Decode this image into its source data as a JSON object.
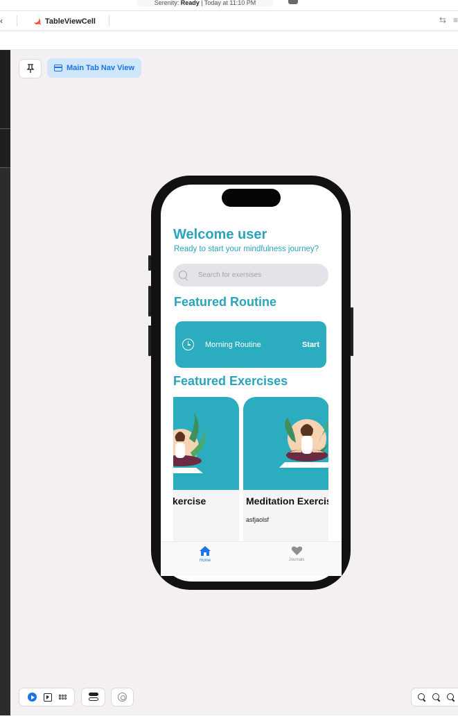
{
  "window": {
    "status_text_prefix": "Serenity: ",
    "status_text_bold": "Ready",
    "status_text_suffix": " | Today at 11:10 PM"
  },
  "editor_tabs": {
    "prev_tab": "‹",
    "active_file": "TableViewCell",
    "active_file_icon": "swift-icon"
  },
  "canvas": {
    "pin_icon": "pin-icon",
    "preview_chip_label": "Main Tab Nav View",
    "accent": "#1a73e8",
    "bottom_controls": [
      "play-icon",
      "cursor-icon",
      "grid-icon",
      "toggle-icon",
      "target-icon"
    ],
    "zoom_controls": [
      "zoom-out-icon",
      "zoom-fit-icon",
      "zoom-in-icon"
    ]
  },
  "app": {
    "brand_color": "#2aa3bd",
    "welcome_title": "Welcome user",
    "welcome_subtitle": "Ready to start your mindfulness journey?",
    "search_placeholder": "Search for exersises",
    "featured_routine_heading": "Featured Routine",
    "routine": {
      "name": "Morning Routine",
      "action": "Start",
      "icon": "clock-icon"
    },
    "featured_exercises_heading": "Featured Exercises",
    "exercises": [
      {
        "title": "kercise",
        "description": ""
      },
      {
        "title": "Meditation Exercis",
        "description": "asfjaolsf"
      }
    ],
    "tabs": [
      {
        "label": "Home",
        "icon": "house-icon",
        "selected": true
      },
      {
        "label": "Journals",
        "icon": "heart-icon",
        "selected": false
      }
    ]
  }
}
